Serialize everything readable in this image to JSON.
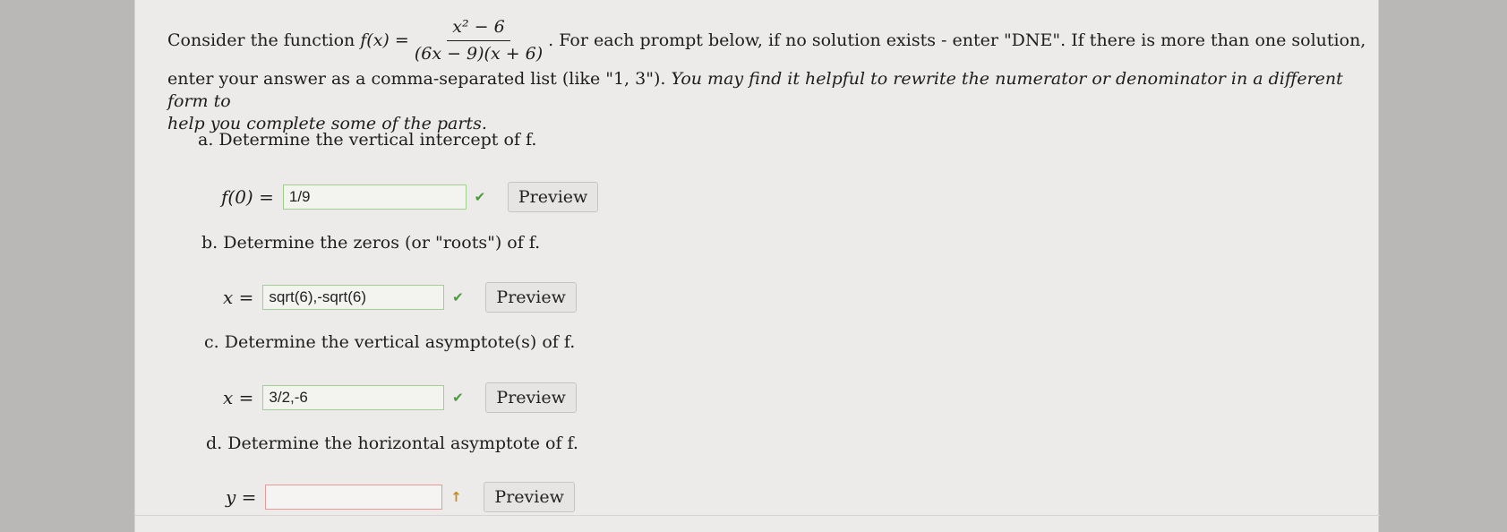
{
  "intro": {
    "prefix": "Consider the function",
    "fn_lhs": "f(x) =",
    "numerator": "x² − 6",
    "denominator": "(6x − 9)(x + 6)",
    "after_fraction": ". For each prompt below, if no solution exists - enter \"DNE\". If there is more than one solution,",
    "line2_plain": "enter your answer as a comma-separated list (like \"1, 3\"). ",
    "line2_italic": "You may find it helpful to rewrite the numerator or denominator in a different form to",
    "line3_italic": "help you complete some of the parts."
  },
  "parts": [
    {
      "label": "a. Determine the vertical intercept of f.",
      "lhs": "f(0) =",
      "value": "1/9",
      "status": "correct",
      "status_icon": "✔",
      "preview_label": "Preview"
    },
    {
      "label": "b. Determine the zeros (or \"roots\") of f.",
      "lhs": "x =",
      "value": "sqrt(6),-sqrt(6)",
      "status": "correct",
      "status_icon": "✔",
      "preview_label": "Preview"
    },
    {
      "label": "c. Determine the vertical asymptote(s) of f.",
      "lhs": "x =",
      "value": "3/2,-6",
      "status": "correct",
      "status_icon": "✔",
      "preview_label": "Preview"
    },
    {
      "label": "d. Determine the horizontal asymptote of f.",
      "lhs": "y =",
      "value": "",
      "status": "empty",
      "status_icon": "↑",
      "preview_label": "Preview"
    }
  ],
  "colors": {
    "correct_border": "#9fd08f",
    "empty_border": "#e59a9a",
    "check": "#4b9a3a",
    "warn": "#c98a1a"
  }
}
